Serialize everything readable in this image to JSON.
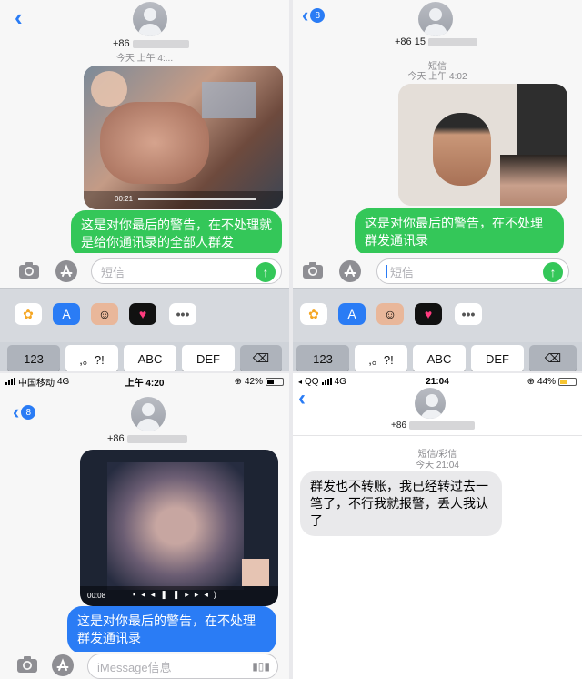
{
  "panels": {
    "p1": {
      "contact": "+86",
      "timestamp": "今天 上午 4:...",
      "message": "这是对你最后的警告，在不处理就是给你通讯录的全部人群发",
      "input_placeholder": "短信",
      "video_time": "00:21",
      "keys": [
        "123",
        ",。?!",
        "ABC",
        "DEF"
      ]
    },
    "p2": {
      "back_badge": "8",
      "contact": "+86 15",
      "service_label": "短信",
      "timestamp": "今天 上午 4:02",
      "message": "这是对你最后的警告，在不处理群发通讯录",
      "input_placeholder": "短信",
      "keys": [
        "123",
        ",。?!",
        "ABC",
        "DEF"
      ]
    },
    "p3": {
      "status_carrier": "中国移动",
      "status_network": "4G",
      "status_time": "上午 4:20",
      "status_battery": "42%",
      "back_badge": "8",
      "contact": "+86",
      "video_time": "00:08",
      "message": "这是对你最后的警告，在不处理群发通讯录",
      "input_placeholder": "iMessage信息"
    },
    "p4": {
      "status_carrier": "QQ",
      "status_network": "4G",
      "status_time": "21:04",
      "status_battery": "44%",
      "contact": "+86",
      "service_label": "短信/彩信",
      "timestamp": "今天 21:04",
      "message": "群发也不转账，我已经转过去一笔了，不行我就报警，丢人我认了"
    }
  },
  "colors": {
    "sent_bubble": "#34c759",
    "received_bubble": "#e9e9eb",
    "ios_blue": "#2a7cf5"
  }
}
